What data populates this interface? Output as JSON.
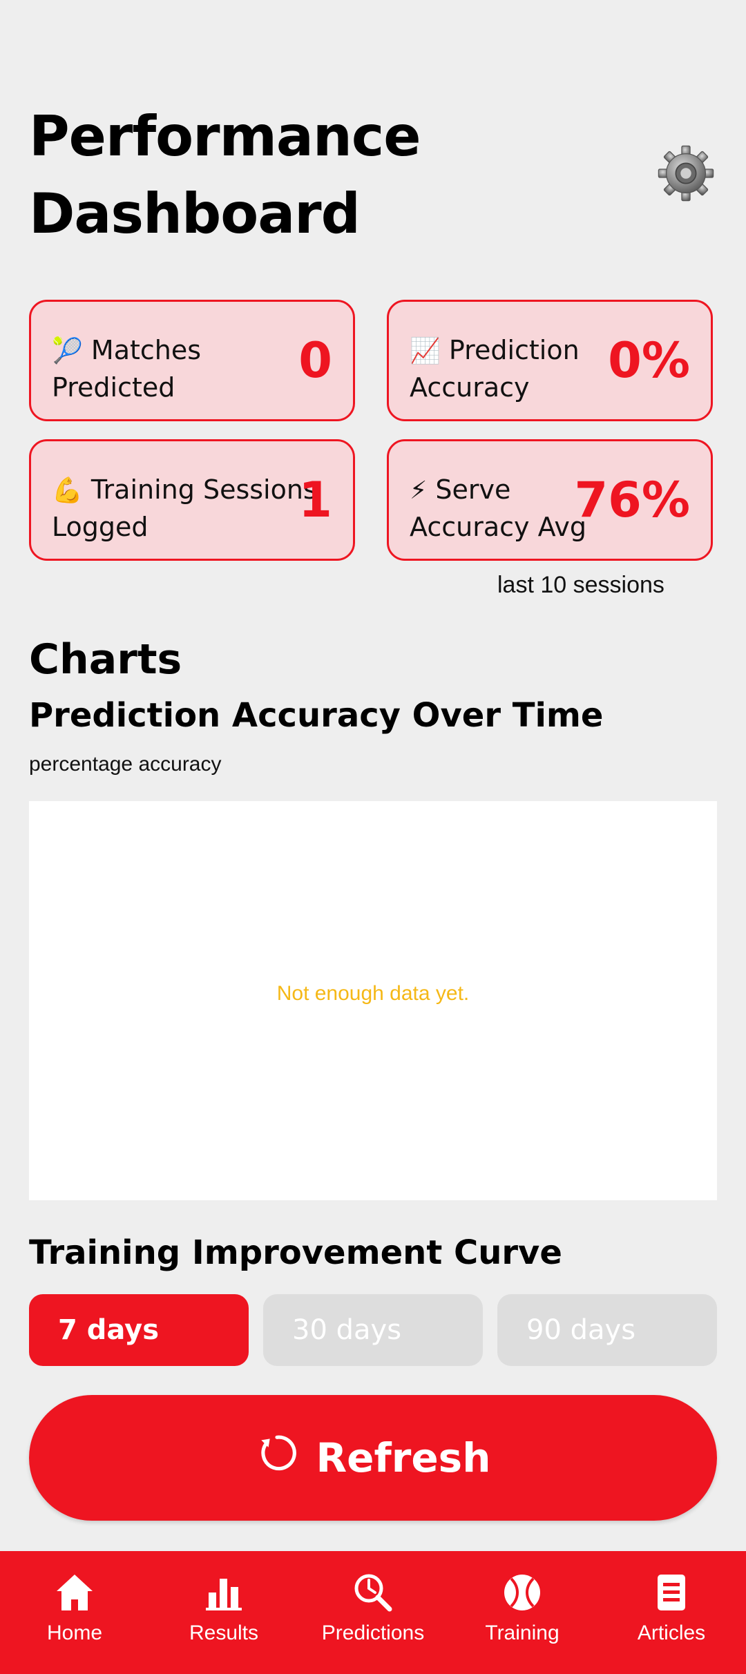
{
  "header": {
    "title_line1": "Performance",
    "title_line2": "Dashboard"
  },
  "stats": [
    {
      "emoji": "🎾",
      "label_line1": "Matches",
      "label_line2": "Predicted",
      "value": "0"
    },
    {
      "emoji": "📈",
      "label_line1": "Prediction",
      "label_line2": "Accuracy",
      "value": "0%"
    },
    {
      "emoji": "💪",
      "label_line1": "Training Sessions",
      "label_line2": "Logged",
      "value": "1"
    },
    {
      "emoji": "⚡",
      "label_line1": "Serve",
      "label_line2": "Accuracy Avg",
      "value": "76%"
    }
  ],
  "serve_note": "last 10 sessions",
  "charts": {
    "heading": "Charts",
    "prediction_title": "Prediction Accuracy Over Time",
    "prediction_subtitle": "percentage accuracy",
    "empty_message": "Not enough data yet.",
    "training_title": "Training Improvement Curve"
  },
  "ranges": [
    {
      "label": "7 days",
      "active": true
    },
    {
      "label": "30 days",
      "active": false
    },
    {
      "label": "90 days",
      "active": false
    }
  ],
  "refresh_label": "Refresh",
  "nav": [
    {
      "label": "Home",
      "icon": "home-icon"
    },
    {
      "label": "Results",
      "icon": "bar-chart-icon"
    },
    {
      "label": "Predictions",
      "icon": "magnifier-chart-icon"
    },
    {
      "label": "Training",
      "icon": "tennis-ball-icon"
    },
    {
      "label": "Articles",
      "icon": "document-icon"
    }
  ],
  "colors": {
    "accent": "#ee1521",
    "card_bg": "#f8d7da",
    "empty_text": "#f5b817",
    "inactive_tab": "#dddddd"
  }
}
